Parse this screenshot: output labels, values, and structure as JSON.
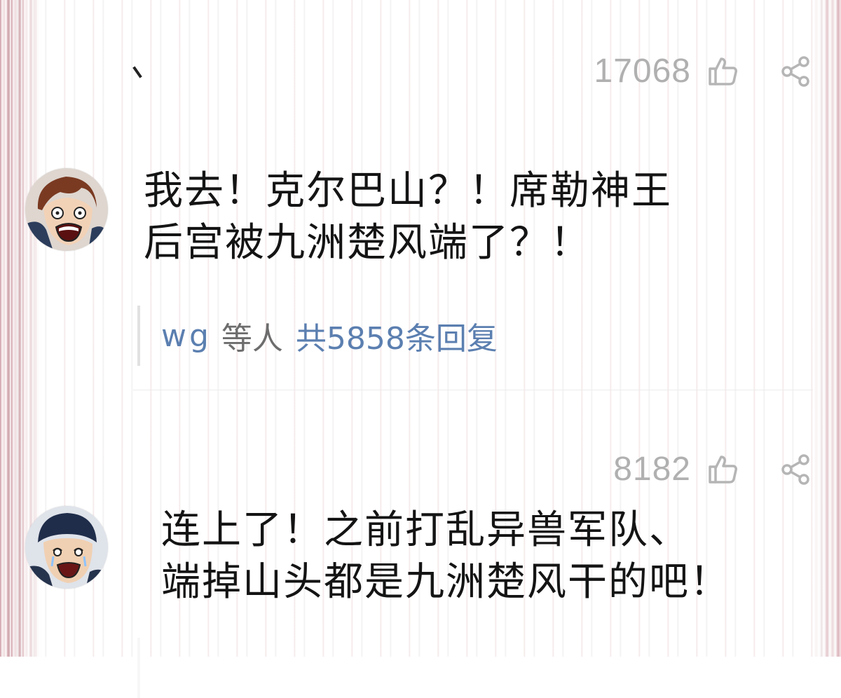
{
  "comments": [
    {
      "likes": "17068",
      "avatar": "shocked-brown-hair-character",
      "text": "我去！克尔巴山？！席勒神王\n后宫被九洲楚风端了？！",
      "replies": {
        "users": "wg",
        "mid": "等人",
        "link": "共5858条回复"
      }
    },
    {
      "likes": "8182",
      "avatar": "crying-helmet-character",
      "text": "连上了！之前打乱异兽军队、\n端掉山头都是九洲楚风干的吧！",
      "replies": {
        "users": "",
        "mid": "",
        "link": ""
      }
    }
  ],
  "icons": {
    "like": "thumbs-up-outline-icon",
    "share": "share-nodes-icon"
  },
  "colors": {
    "text": "#141414",
    "link": "#5b7fb0",
    "muted": "#b0b0b0"
  }
}
